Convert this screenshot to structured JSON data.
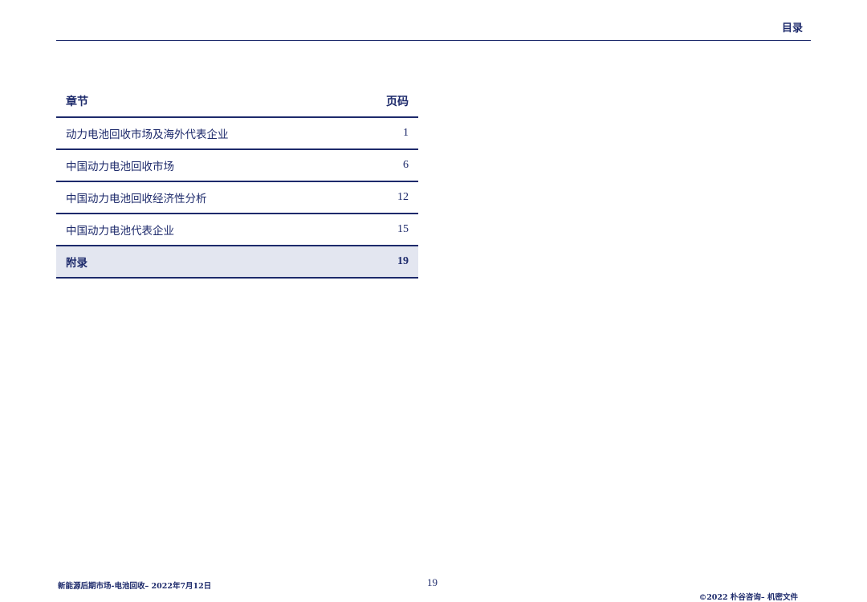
{
  "header": {
    "title": "目录"
  },
  "toc": {
    "col_chapter": "章节",
    "col_page": "页码",
    "rows": [
      {
        "title": "动力电池回收市场及海外代表企业",
        "page": "1"
      },
      {
        "title": "中国动力电池回收市场",
        "page": "6"
      },
      {
        "title": "中国动力电池回收经济性分析",
        "page": "12"
      },
      {
        "title": "中国动力电池代表企业",
        "page": "15"
      },
      {
        "title": "附录",
        "page": "19"
      }
    ],
    "active_index": 4
  },
  "footer": {
    "report_line": "新能源后期市场-电池回收– 2022年7月12日",
    "page_number": "19",
    "copyright": "©2022 朴谷咨询– 机密文件"
  },
  "colors": {
    "primary": "#1d2a6b",
    "highlight_bg": "#e3e6f0"
  }
}
